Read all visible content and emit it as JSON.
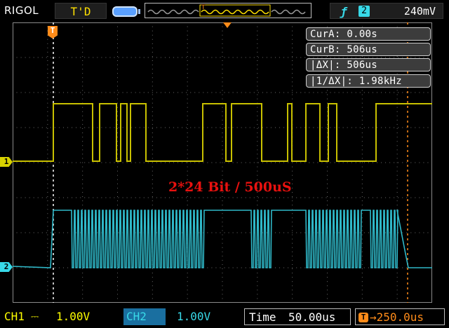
{
  "topbar": {
    "brand": "RIGOL",
    "run_status": "T'D",
    "trigger_edge_icon": "rising-edge-icon",
    "trigger_source": "2",
    "trigger_level": "240mV"
  },
  "cursors": {
    "cur_a": "CurA: 0.00s",
    "cur_b": "CurB: 506us",
    "delta_x": "|ΔX|: 506us",
    "inv_delta_x": "|1/ΔX|: 1.98kHz",
    "cursor_a_flag": "T"
  },
  "annotation": "2*24 Bit / 500uS",
  "markers": {
    "ch1": "1",
    "ch2": "2"
  },
  "bottombar": {
    "ch1_label": "CH1",
    "ch1_coupling": "⎓",
    "ch1_scale": "1.00V",
    "ch2_label": "CH2",
    "ch2_coupling": "⎓",
    "ch2_scale": "1.00V",
    "time_label": "Time",
    "time_scale": "50.00us",
    "offset_icon": "T",
    "trigger_offset": "→250.0us"
  },
  "colors": {
    "ch1": "#c8c000",
    "ch2": "#2fb8c8",
    "cursor": "#ff8c1a",
    "annotation": "#e8110f",
    "grid": "#5a5a5a"
  }
}
